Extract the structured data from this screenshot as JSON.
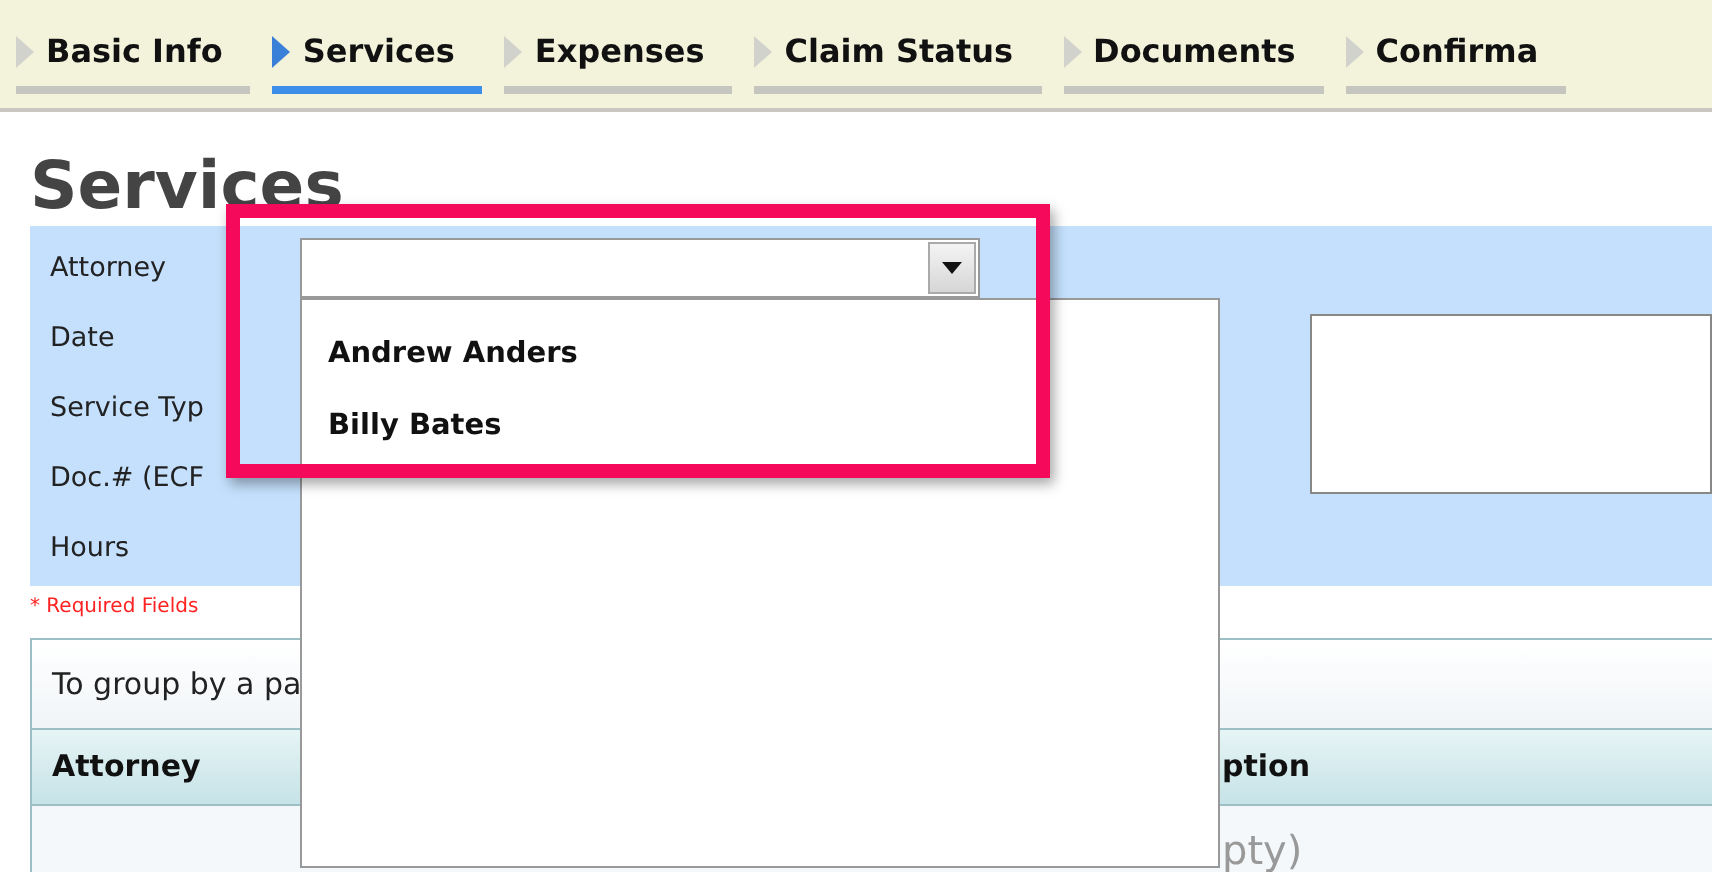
{
  "tabs": [
    {
      "label": "Basic Info",
      "selected": false
    },
    {
      "label": "Services",
      "selected": true
    },
    {
      "label": "Expenses",
      "selected": false
    },
    {
      "label": "Claim Status",
      "selected": false
    },
    {
      "label": "Documents",
      "selected": false
    },
    {
      "label": "Confirma",
      "selected": false
    }
  ],
  "heading": "Services",
  "form": {
    "fields": [
      {
        "label": "Attorney"
      },
      {
        "label": "Date"
      },
      {
        "label": "Service Typ"
      },
      {
        "label": "Doc.# (ECF"
      },
      {
        "label": "Hours"
      }
    ],
    "required_note": "* Required Fields"
  },
  "attorney_dropdown": {
    "expanded": true,
    "options": [
      {
        "label": "Andrew Anders"
      },
      {
        "label": "Billy Bates"
      }
    ]
  },
  "grid": {
    "group_hint": "To group by a pa",
    "columns": [
      "Attorney",
      "ption"
    ],
    "empty_text": "pty)"
  }
}
